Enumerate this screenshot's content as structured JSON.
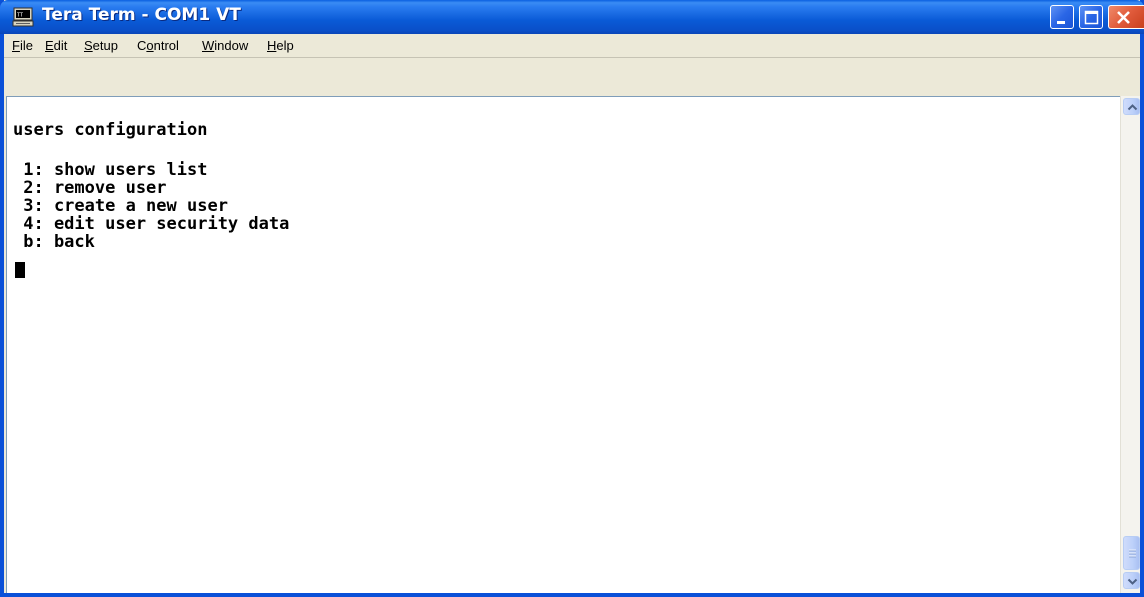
{
  "window": {
    "title": "Tera Term - COM1 VT"
  },
  "menu": {
    "items": [
      {
        "label": "File",
        "accel": "F",
        "rest": "ile"
      },
      {
        "label": "Edit",
        "accel": "E",
        "rest": "dit"
      },
      {
        "label": "Setup",
        "accel": "S",
        "rest": "etup"
      },
      {
        "label": "Control",
        "pre": "C",
        "accel": "o",
        "rest": "ntrol"
      },
      {
        "label": "Window",
        "accel": "W",
        "rest": "indow"
      },
      {
        "label": "Help",
        "accel": "H",
        "rest": "elp"
      }
    ]
  },
  "terminal": {
    "heading": "users configuration",
    "options": [
      " 1: show users list",
      " 2: remove user",
      " 3: create a new user",
      " 4: edit user security data",
      " b: back"
    ]
  },
  "icons": {
    "app": "terminal-computer-icon",
    "minimize": "minimize-icon",
    "maximize": "maximize-icon",
    "close": "close-icon",
    "scroll_up": "chevron-up-icon",
    "scroll_down": "chevron-down-icon",
    "scroll_grip": "grip-icon"
  },
  "colors": {
    "titlebar": "#0a5ad6",
    "close_button": "#e05a3a",
    "terminal_bg": "#ffffff",
    "terminal_fg": "#000000"
  }
}
